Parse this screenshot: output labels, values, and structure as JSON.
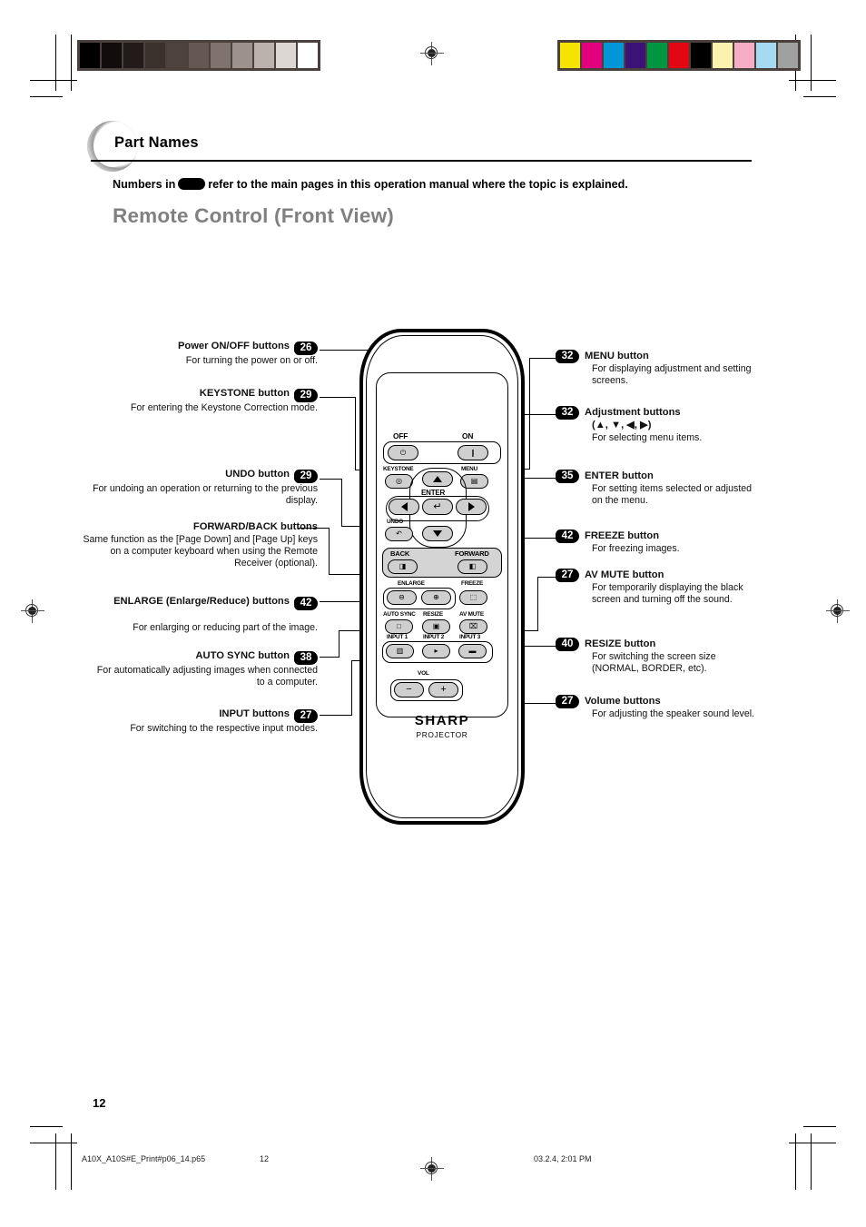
{
  "header": {
    "section_title": "Part Names",
    "lead_before": "Numbers in",
    "lead_after": "refer to the main pages in this operation manual where the topic is explained.",
    "subtitle": "Remote Control (Front View)"
  },
  "callouts_left": [
    {
      "title": "Power ON/OFF buttons",
      "page": "26",
      "desc": "For turning the power on or off."
    },
    {
      "title": "KEYSTONE button",
      "page": "29",
      "desc": "For entering the Keystone Correction mode."
    },
    {
      "title": "UNDO button",
      "page": "29",
      "desc": "For undoing an operation or returning to the previous display."
    },
    {
      "title": "FORWARD/BACK buttons",
      "page": "",
      "desc": "Same function as the [Page Down] and [Page Up] keys on a computer keyboard when using the Remote Receiver (optional)."
    },
    {
      "title": "ENLARGE (Enlarge/Reduce) buttons",
      "page": "42",
      "desc": "For enlarging or reducing part of the image."
    },
    {
      "title": "AUTO SYNC button",
      "page": "38",
      "desc": "For automatically adjusting images when connected to a computer."
    },
    {
      "title": "INPUT buttons",
      "page": "27",
      "desc": "For switching to the respective input modes."
    }
  ],
  "callouts_right": [
    {
      "title": "MENU button",
      "page": "32",
      "desc": "For displaying adjustment and setting screens."
    },
    {
      "title": "Adjustment buttons",
      "title2": "(▲, ▼, ◀, ▶)",
      "page": "32",
      "desc": "For selecting menu items."
    },
    {
      "title": "ENTER button",
      "page": "35",
      "desc": "For setting items selected or adjusted on the menu."
    },
    {
      "title": "FREEZE button",
      "page": "42",
      "desc": "For freezing images."
    },
    {
      "title": "AV MUTE button",
      "page": "27",
      "desc": "For temporarily displaying the black screen and turning off the sound."
    },
    {
      "title": "RESIZE button",
      "page": "40",
      "desc": "For switching the screen size (NORMAL, BORDER, etc)."
    },
    {
      "title": "Volume buttons",
      "page": "27",
      "desc": "For adjusting the speaker sound level."
    }
  ],
  "remote": {
    "brand": "SHARP",
    "brand_sub": "PROJECTOR",
    "labels": {
      "off": "OFF",
      "on": "ON",
      "keystone": "KEYSTONE",
      "menu": "MENU",
      "enter": "ENTER",
      "undo": "UNDO",
      "back": "BACK",
      "forward": "FORWARD",
      "enlarge": "ENLARGE",
      "freeze": "FREEZE",
      "auto_sync": "AUTO SYNC",
      "resize": "RESIZE",
      "av_mute": "AV MUTE",
      "input1": "INPUT 1",
      "input2": "INPUT 2",
      "input3": "INPUT 3",
      "vol": "VOL"
    },
    "glyphs": {
      "power_off": "⏻",
      "power_on": "❙",
      "keystone": "◎",
      "menu": "▤",
      "enter": "↵",
      "undo": "↶",
      "back": "◨",
      "forward": "◧",
      "enlarge_minus": "⊖",
      "enlarge_plus": "⊕",
      "freeze": "⬚",
      "auto_sync": "□",
      "resize": "▣",
      "av_mute": "⌧",
      "input1": "▥",
      "input2": "▸",
      "input3": "▬",
      "vol_minus": "−",
      "vol_plus": "+"
    }
  },
  "footer": {
    "page_number": "12",
    "filename": "A10X_A10S#E_Print#p06_14.p65",
    "center_page": "12",
    "timestamp": "03.2.4, 2:01 PM"
  },
  "colors": {
    "gray_bar": [
      "#000000",
      "#120d0c",
      "#221b19",
      "#3a302c",
      "#4e423d",
      "#655853",
      "#80736d",
      "#9c918b",
      "#bbb2ad",
      "#dcd7d3",
      "#ffffff"
    ],
    "color_bar": [
      "#f5e400",
      "#e2007f",
      "#0096d8",
      "#3d1278",
      "#009540",
      "#e30613",
      "#000000",
      "#fbf2b0",
      "#f5aec6",
      "#a6d9f2",
      "#9fa0a0"
    ],
    "subtitle_gray": "#808080"
  }
}
